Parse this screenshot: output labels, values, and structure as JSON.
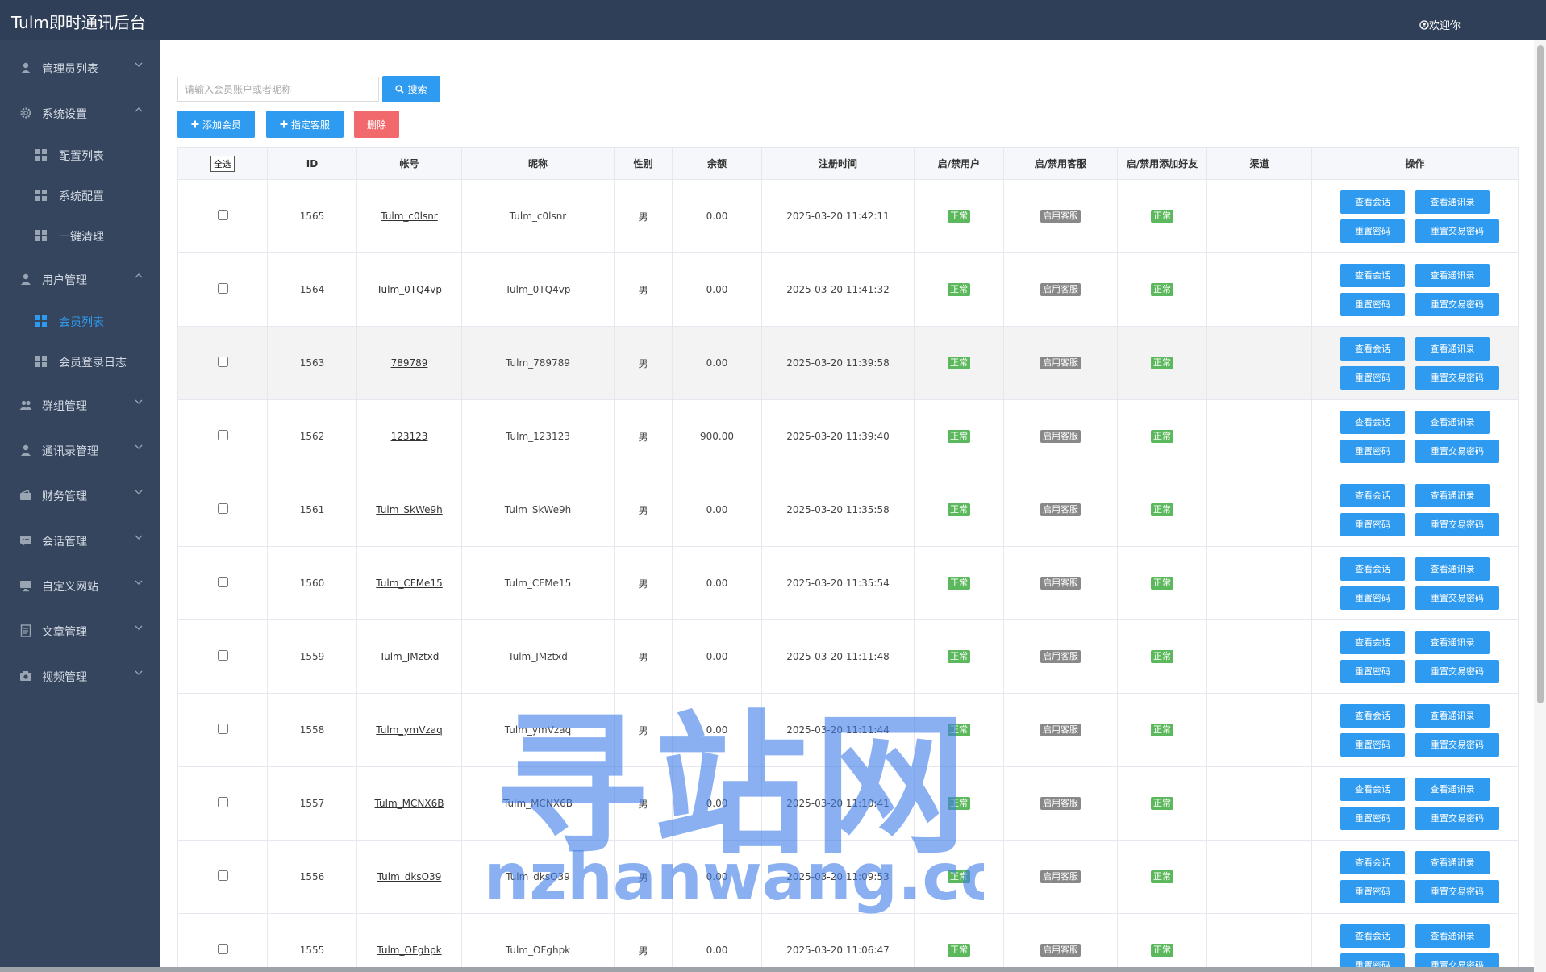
{
  "app": {
    "title": "Tulm即时通讯后台",
    "welcome": "欢迎你"
  },
  "sidebar": {
    "items": [
      {
        "label": "管理员列表",
        "icon": "user-icon",
        "expanded": false
      },
      {
        "label": "系统设置",
        "icon": "gear-icon",
        "expanded": true,
        "children": [
          {
            "label": "配置列表"
          },
          {
            "label": "系统配置"
          },
          {
            "label": "一键清理"
          }
        ]
      },
      {
        "label": "用户管理",
        "icon": "user-icon",
        "expanded": true,
        "children": [
          {
            "label": "会员列表",
            "active": true
          },
          {
            "label": "会员登录日志"
          }
        ]
      },
      {
        "label": "群组管理",
        "icon": "group-icon",
        "expanded": false
      },
      {
        "label": "通讯录管理",
        "icon": "user-icon",
        "expanded": false
      },
      {
        "label": "财务管理",
        "icon": "wallet-icon",
        "expanded": false
      },
      {
        "label": "会话管理",
        "icon": "chat-icon",
        "expanded": false
      },
      {
        "label": "自定义网站",
        "icon": "monitor-icon",
        "expanded": false
      },
      {
        "label": "文章管理",
        "icon": "document-icon",
        "expanded": false
      },
      {
        "label": "视频管理",
        "icon": "camera-icon",
        "expanded": false
      }
    ]
  },
  "toolbar": {
    "search_placeholder": "请输入会员账户或者昵称",
    "search_label": "搜索",
    "add_member_label": "添加会员",
    "assign_service_label": "指定客服",
    "delete_label": "删除"
  },
  "table": {
    "select_all_label": "全选",
    "columns": [
      "ID",
      "帐号",
      "昵称",
      "性别",
      "余额",
      "注册时间",
      "启/禁用户",
      "启/禁用客服",
      "启/禁用添加好友",
      "渠道",
      "操作"
    ],
    "actions": [
      "查看会话",
      "查看通讯录",
      "重置密码",
      "重置交易密码"
    ],
    "rows": [
      {
        "id": "1565",
        "account": "Tulm_c0lsnr",
        "nickname": "Tulm_c0lsnr",
        "gender": "男",
        "balance": "0.00",
        "registered": "2025-03-20 11:42:11",
        "user_status": "正常",
        "service_status": "启用客服",
        "friend_status": "正常",
        "channel": ""
      },
      {
        "id": "1564",
        "account": "Tulm_0TQ4vp",
        "nickname": "Tulm_0TQ4vp",
        "gender": "男",
        "balance": "0.00",
        "registered": "2025-03-20 11:41:32",
        "user_status": "正常",
        "service_status": "启用客服",
        "friend_status": "正常",
        "channel": ""
      },
      {
        "id": "1563",
        "account": "789789",
        "nickname": "Tulm_789789",
        "gender": "男",
        "balance": "0.00",
        "registered": "2025-03-20 11:39:58",
        "user_status": "正常",
        "service_status": "启用客服",
        "friend_status": "正常",
        "channel": ""
      },
      {
        "id": "1562",
        "account": "123123",
        "nickname": "Tulm_123123",
        "gender": "男",
        "balance": "900.00",
        "registered": "2025-03-20 11:39:40",
        "user_status": "正常",
        "service_status": "启用客服",
        "friend_status": "正常",
        "channel": ""
      },
      {
        "id": "1561",
        "account": "Tulm_SkWe9h",
        "nickname": "Tulm_SkWe9h",
        "gender": "男",
        "balance": "0.00",
        "registered": "2025-03-20 11:35:58",
        "user_status": "正常",
        "service_status": "启用客服",
        "friend_status": "正常",
        "channel": ""
      },
      {
        "id": "1560",
        "account": "Tulm_CFMe15",
        "nickname": "Tulm_CFMe15",
        "gender": "男",
        "balance": "0.00",
        "registered": "2025-03-20 11:35:54",
        "user_status": "正常",
        "service_status": "启用客服",
        "friend_status": "正常",
        "channel": ""
      },
      {
        "id": "1559",
        "account": "Tulm_JMztxd",
        "nickname": "Tulm_JMztxd",
        "gender": "男",
        "balance": "0.00",
        "registered": "2025-03-20 11:11:48",
        "user_status": "正常",
        "service_status": "启用客服",
        "friend_status": "正常",
        "channel": ""
      },
      {
        "id": "1558",
        "account": "Tulm_ymVzaq",
        "nickname": "Tulm_ymVzaq",
        "gender": "男",
        "balance": "0.00",
        "registered": "2025-03-20 11:11:44",
        "user_status": "正常",
        "service_status": "启用客服",
        "friend_status": "正常",
        "channel": ""
      },
      {
        "id": "1557",
        "account": "Tulm_MCNX6B",
        "nickname": "Tulm_MCNX6B",
        "gender": "男",
        "balance": "0.00",
        "registered": "2025-03-20 11:10:41",
        "user_status": "正常",
        "service_status": "启用客服",
        "friend_status": "正常",
        "channel": ""
      },
      {
        "id": "1556",
        "account": "Tulm_dksO39",
        "nickname": "Tulm_dksO39",
        "gender": "男",
        "balance": "0.00",
        "registered": "2025-03-20 11:09:53",
        "user_status": "正常",
        "service_status": "启用客服",
        "friend_status": "正常",
        "channel": ""
      },
      {
        "id": "1555",
        "account": "Tulm_OFghpk",
        "nickname": "Tulm_OFghpk",
        "gender": "男",
        "balance": "0.00",
        "registered": "2025-03-20 11:06:47",
        "user_status": "正常",
        "service_status": "启用客服",
        "friend_status": "正常",
        "channel": ""
      }
    ]
  },
  "watermark": {
    "title": "寻站网",
    "url": "xunzhanwang.com"
  },
  "colors": {
    "topbar": "#2f3f57",
    "sidebar": "#35455d",
    "primary": "#2f9bf0",
    "danger": "#f1696c",
    "success": "#5cb85c",
    "muted": "#888888"
  }
}
